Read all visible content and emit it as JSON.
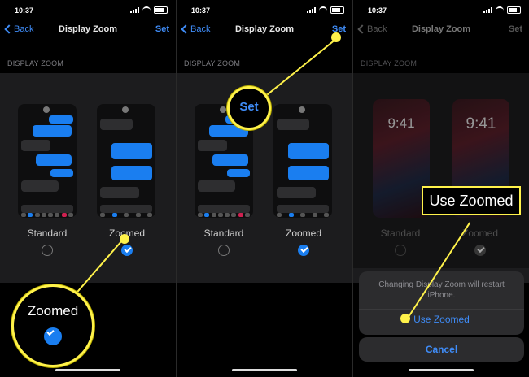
{
  "status": {
    "time": "10:37"
  },
  "panels": [
    {
      "nav": {
        "back_label": "Back",
        "title": "Display Zoom",
        "set_label": "Set"
      },
      "section_header": "DISPLAY ZOOM",
      "options": {
        "standard_label": "Standard",
        "zoomed_label": "Zoomed",
        "selected": "zoomed"
      },
      "callout": {
        "label": "Zoomed"
      }
    },
    {
      "nav": {
        "back_label": "Back",
        "title": "Display Zoom",
        "set_label": "Set"
      },
      "section_header": "DISPLAY ZOOM",
      "options": {
        "standard_label": "Standard",
        "zoomed_label": "Zoomed",
        "selected": "zoomed"
      },
      "callout": {
        "label": "Set"
      }
    },
    {
      "nav": {
        "back_label": "Back",
        "title": "Display Zoom",
        "set_label": "Set"
      },
      "section_header": "DISPLAY ZOOM",
      "options": {
        "standard_label": "Standard",
        "zoomed_label": "Zoomed",
        "selected": "zoomed"
      },
      "lock_time": "9:41",
      "action_sheet": {
        "message": "Changing Display Zoom will restart iPhone.",
        "confirm_label": "Use Zoomed",
        "cancel_label": "Cancel"
      },
      "callout": {
        "label": "Use Zoomed"
      }
    }
  ],
  "colors": {
    "accent": "#3f8cf7",
    "highlight": "#fff24a",
    "background": "#000000"
  }
}
